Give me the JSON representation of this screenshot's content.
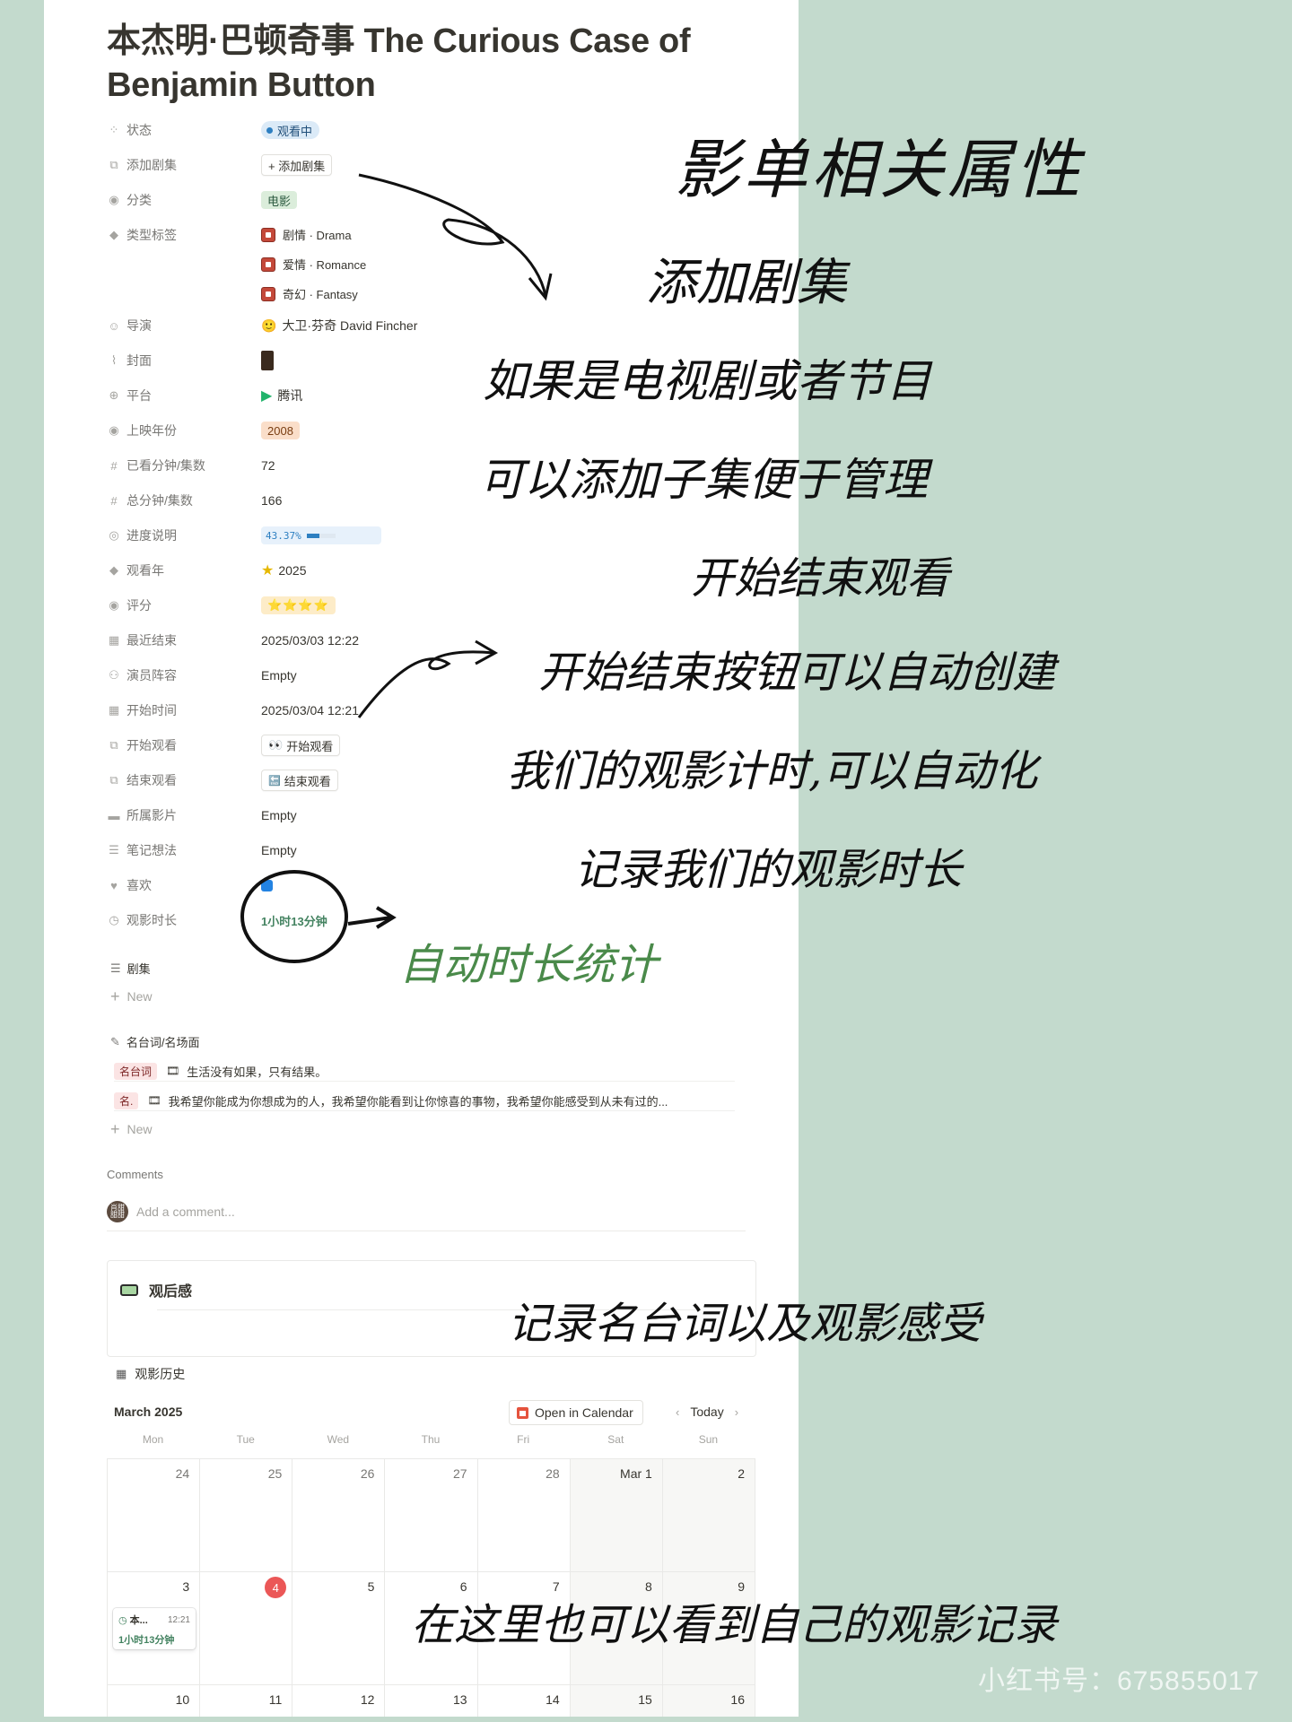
{
  "title": "本杰明·巴顿奇事 The Curious Case of Benjamin Button",
  "props": {
    "status": {
      "label": "状态",
      "value": "观看中"
    },
    "add_episode": {
      "label": "添加剧集",
      "value": "+ 添加剧集"
    },
    "category": {
      "label": "分类",
      "value": "电影"
    },
    "genre_tags": {
      "label": "类型标签",
      "items": [
        "剧情 · Drama",
        "爱情 · Romance",
        "奇幻 · Fantasy"
      ]
    },
    "director": {
      "label": "导演",
      "value": "大卫·芬奇 David Fincher"
    },
    "cover": {
      "label": "封面"
    },
    "platform": {
      "label": "平台",
      "value": "腾讯"
    },
    "release_year": {
      "label": "上映年份",
      "value": "2008"
    },
    "watched_min": {
      "label": "已看分钟/集数",
      "value": "72"
    },
    "total_min": {
      "label": "总分钟/集数",
      "value": "166"
    },
    "progress": {
      "label": "进度说明",
      "value": "43.37%",
      "fraction": 0.4337
    },
    "watch_year": {
      "label": "观看年",
      "value": "2025"
    },
    "rating": {
      "label": "评分",
      "value": "⭐⭐⭐⭐",
      "stars": 4
    },
    "last_end": {
      "label": "最近结束",
      "value": "2025/03/03 12:22"
    },
    "cast": {
      "label": "演员阵容",
      "value": "Empty"
    },
    "start_time": {
      "label": "开始时间",
      "value": "2025/03/04 12:21"
    },
    "start_watch": {
      "label": "开始观看",
      "value": "开始观看"
    },
    "end_watch": {
      "label": "结束观看",
      "value": "结束观看"
    },
    "parent_film": {
      "label": "所属影片",
      "value": "Empty"
    },
    "notes": {
      "label": "笔记想法",
      "value": "Empty"
    },
    "like": {
      "label": "喜欢",
      "checked": true
    },
    "duration": {
      "label": "观影时长",
      "value": "1小时13分钟"
    }
  },
  "episodes": {
    "label": "剧集",
    "new": "New"
  },
  "quotes": {
    "label": "名台词/名场面",
    "rows": [
      {
        "tag": "名台词",
        "text": "生活没有如果，只有结果。"
      },
      {
        "tag": "名.",
        "text": "我希望你能成为你想成为的人，我希望你能看到让你惊喜的事物，我希望你能感受到从未有过的..."
      }
    ],
    "new": "New"
  },
  "comments": {
    "label": "Comments",
    "placeholder": "Add a comment...",
    "avatar": "肖甜\n甜甜"
  },
  "review": {
    "title": "观后感"
  },
  "history": {
    "title": "观影历史",
    "month": "March 2025",
    "open_btn": "Open in Calendar",
    "today_btn": "Today",
    "weekdays": [
      "Mon",
      "Tue",
      "Wed",
      "Thu",
      "Fri",
      "Sat",
      "Sun"
    ],
    "days": [
      "24",
      "25",
      "26",
      "27",
      "28",
      "Mar 1",
      "2",
      "3",
      "4",
      "5",
      "6",
      "7",
      "8",
      "9",
      "10",
      "11",
      "12",
      "13",
      "14",
      "15",
      "16"
    ],
    "today_index": 8,
    "event": {
      "title": "本...",
      "time": "12:21",
      "duration": "1小时13分钟"
    }
  },
  "annotations": {
    "a1": "影单相关属性",
    "a2": "添加剧集",
    "a3": "如果是电视剧或者节目",
    "a4": "可以添加子集便于管理",
    "a5": "开始结束观看",
    "a6": "开始结束按钮可以自动创建",
    "a7": "我们的观影计时,可以自动化",
    "a8": "记录我们的观影时长",
    "a9": "自动时长统计",
    "a10": "记录名台词以及观影感受",
    "a11": "在这里也可以看到自己的观影记录"
  },
  "watermark": "小红书号：675855017",
  "colors": {
    "background": "#c3dacd",
    "accent_green": "#448361",
    "today_red": "#eb5757"
  }
}
